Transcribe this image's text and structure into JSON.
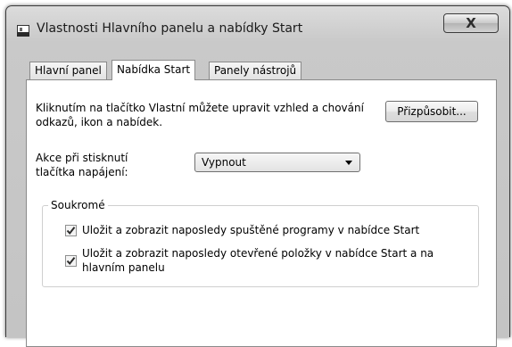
{
  "window": {
    "title": "Vlastnosti Hlavního panelu a nabídky Start",
    "close_label": "X"
  },
  "tabs": [
    {
      "label": "Hlavní panel"
    },
    {
      "label": "Nabídka Start"
    },
    {
      "label": "Panely nástrojů"
    }
  ],
  "start_menu": {
    "description": "Kliknutím na tlačítko Vlastní můžete upravit vzhled a chování odkazů, ikon a nabídek.",
    "customize_button": "Přizpůsobit...",
    "power_label": "Akce při stisknutí tlačítka napájení:",
    "power_value": "Vypnout",
    "privacy": {
      "legend": "Soukromé",
      "items": [
        {
          "label": "Uložit a zobrazit naposledy spuštěné programy v nabídce Start",
          "checked": true
        },
        {
          "label": "Uložit a zobrazit naposledy otevřené položky v nabídce Start a na hlavním panelu",
          "checked": true
        }
      ]
    }
  }
}
